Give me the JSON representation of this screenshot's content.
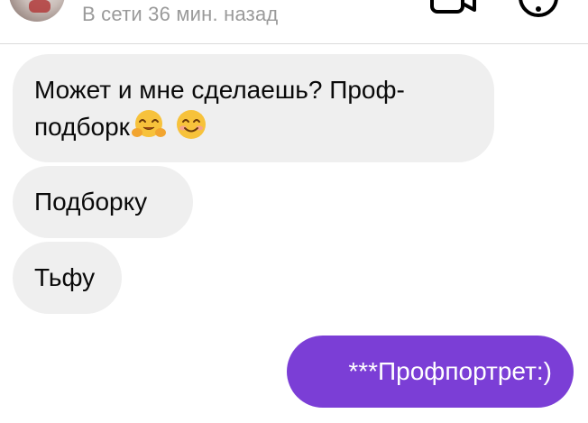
{
  "header": {
    "status": "В сети 36 мин. назад",
    "avatar_icon": "avatar-photo",
    "video_call_icon": "video-camera-icon",
    "info_icon": "info-circle-icon"
  },
  "messages": [
    {
      "direction": "incoming",
      "line1": "Может и мне сделаешь? Проф-",
      "line2": "подборк",
      "emojis": [
        "hugging-face-emoji",
        "smiling-face-emoji"
      ]
    },
    {
      "direction": "incoming",
      "text": "Подборку"
    },
    {
      "direction": "incoming",
      "text": "Тьфу"
    },
    {
      "direction": "outgoing",
      "text": "***Профпортрет:)"
    }
  ],
  "colors": {
    "incoming_bubble": "#efefef",
    "outgoing_bubble": "#7b3ed6",
    "status_text": "#9a9a9a",
    "message_text": "#0a0a0a"
  }
}
